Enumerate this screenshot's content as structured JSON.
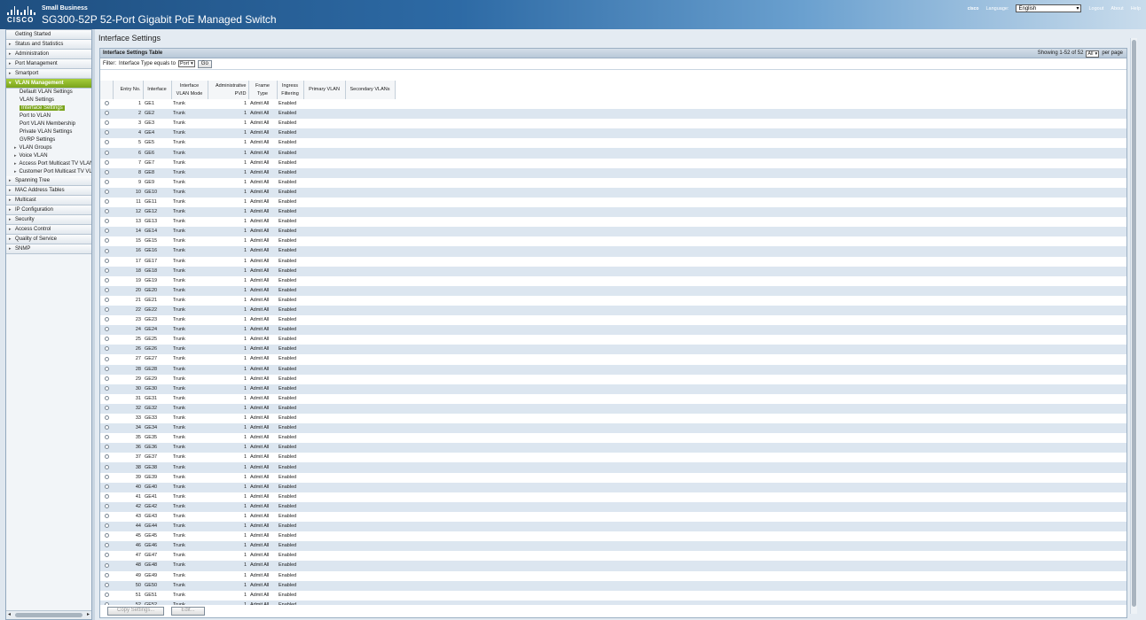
{
  "header": {
    "brand_small": "Small Business",
    "title": "SG300-52P 52-Port Gigabit PoE Managed Switch",
    "logo_text": "CISCO",
    "mini_logo": "cisco",
    "language_label": "Language:",
    "language_value": "English",
    "logout": "Logout",
    "about": "About",
    "help": "Help"
  },
  "sidebar": {
    "items_before": [
      {
        "label": "Getting Started",
        "arrow": ""
      },
      {
        "label": "Status and Statistics",
        "arrow": "▸"
      },
      {
        "label": "Administration",
        "arrow": "▸"
      },
      {
        "label": "Port Management",
        "arrow": "▸"
      },
      {
        "label": "Smartport",
        "arrow": "▸"
      }
    ],
    "active": {
      "label": "VLAN Management",
      "arrow": "▾"
    },
    "subitems": [
      {
        "label": "Default VLAN Settings"
      },
      {
        "label": "VLAN Settings"
      },
      {
        "label": "Interface Settings"
      },
      {
        "label": "Port to VLAN"
      },
      {
        "label": "Port VLAN Membership"
      },
      {
        "label": "Private VLAN Settings"
      },
      {
        "label": "GVRP Settings"
      }
    ],
    "subgroups": [
      {
        "label": "VLAN Groups"
      },
      {
        "label": "Voice VLAN"
      },
      {
        "label": "Access Port Multicast TV VLAN"
      },
      {
        "label": "Customer Port Multicast TV VLAN"
      }
    ],
    "items_after": [
      {
        "label": "Spanning Tree",
        "arrow": "▸"
      },
      {
        "label": "MAC Address Tables",
        "arrow": "▸"
      },
      {
        "label": "Multicast",
        "arrow": "▸"
      },
      {
        "label": "IP Configuration",
        "arrow": "▸"
      },
      {
        "label": "Security",
        "arrow": "▸"
      },
      {
        "label": "Access Control",
        "arrow": "▸"
      },
      {
        "label": "Quality of Service",
        "arrow": "▸"
      },
      {
        "label": "SNMP",
        "arrow": "▸"
      }
    ]
  },
  "main": {
    "page_title": "Interface Settings",
    "panel_title": "Interface Settings Table",
    "showing": "Showing 1-52 of 52",
    "per_page_value": "All",
    "per_page_label": "per page",
    "filter_label": "Filter:",
    "filter_text": "Interface Type equals to",
    "filter_value": "Port",
    "go_label": "Go",
    "columns": {
      "entry": "Entry No.",
      "iface": "Interface",
      "mode_1": "Interface",
      "mode_2": "VLAN Mode",
      "pvid_1": "Administrative",
      "pvid_2": "PVID",
      "frame_1": "Frame",
      "frame_2": "Type",
      "ingress_1": "Ingress",
      "ingress_2": "Filtering",
      "primary": "Primary VLAN",
      "secondary": "Secondary VLANs"
    },
    "row_defaults": {
      "mode": "Trunk",
      "pvid": "1",
      "frame": "Admit All",
      "ingress": "Enabled"
    },
    "row_count": 52,
    "interface_prefix": "GE",
    "copy_button": "Copy Settings...",
    "edit_button": "Edit..."
  }
}
